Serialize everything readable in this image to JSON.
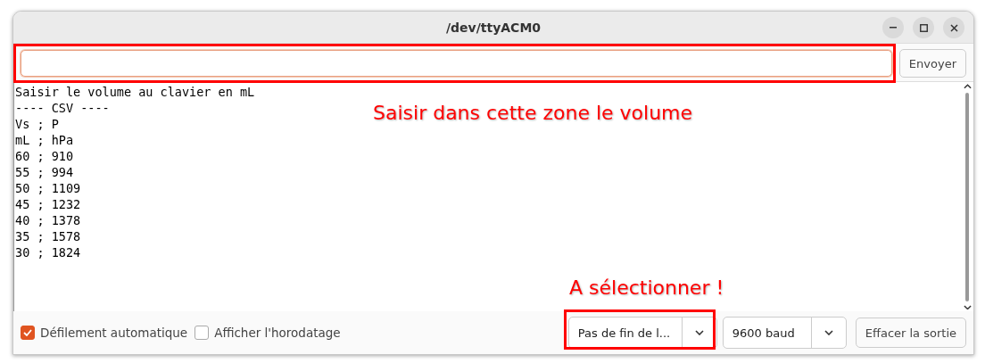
{
  "window": {
    "title": "/dev/ttyACM0"
  },
  "input": {
    "send_button": "Envoyer"
  },
  "output_lines": [
    "Saisir le volume au clavier en mL",
    "---- CSV ----",
    "Vs ; P",
    "mL ; hPa",
    "60 ; 910",
    "55 ; 994",
    "50 ; 1109",
    "45 ; 1232",
    "40 ; 1378",
    "35 ; 1578",
    "30 ; 1824"
  ],
  "footer": {
    "checkboxes": [
      {
        "label": "Défilement automatique",
        "checked": true
      },
      {
        "label": "Afficher l'horodatage",
        "checked": false
      }
    ],
    "line_ending": "Pas de fin de l...",
    "baud": "9600 baud",
    "clear_button": "Effacer la sortie"
  },
  "annotations": [
    {
      "text": "Saisir dans cette zone le volume"
    },
    {
      "text": "A sélectionner !"
    }
  ]
}
